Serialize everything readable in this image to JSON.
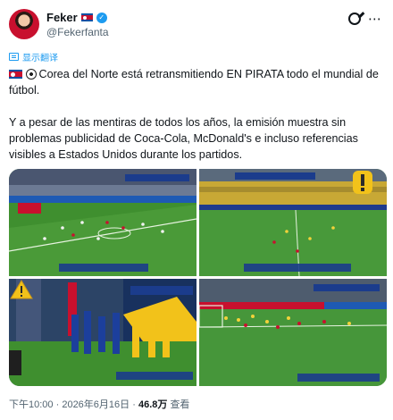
{
  "author": {
    "display_name": "Feker",
    "handle": "@Fekerfanta"
  },
  "header_icons": [
    "grok-icon",
    "more-icon"
  ],
  "translate_label": "显示翻译",
  "post": {
    "paragraph_1": "Corea del Norte está retransmitiendo EN PIRATA todo el mundial de fútbol.",
    "paragraph_2": "Y a pesar de las mentiras de todos los años, la emisión muestra sin problemas publicidad de Coca-Cola, McDonald's e incluso referencias visibles a Estados Unidos durante los partidos."
  },
  "media": {
    "frames": [
      {
        "name": "match-frame-wide-pitch"
      },
      {
        "name": "match-frame-stadium-stands"
      },
      {
        "name": "match-frame-team-walkout"
      },
      {
        "name": "match-frame-yellow-team-attack"
      }
    ],
    "emoji_markers": [
      "exclamation-emoji",
      "warning-emoji"
    ]
  },
  "footer": {
    "time": "下午10:00",
    "separator": "·",
    "date": "2026年6月16日",
    "views_count": "46.8万",
    "views_label": "查看"
  },
  "colors": {
    "accent": "#1d9bf0",
    "pitch": "#3f8f2f",
    "text_secondary": "#536471"
  }
}
